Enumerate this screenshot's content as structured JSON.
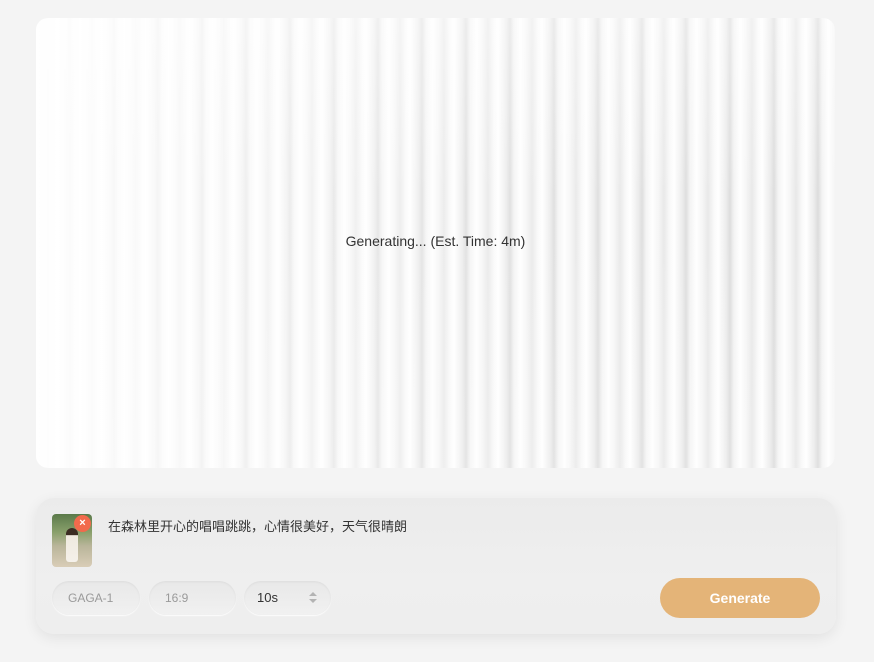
{
  "preview": {
    "status": "Generating... (Est. Time: 4m)"
  },
  "composer": {
    "prompt": "在森林里开心的唱唱跳跳，心情很美好，天气很晴朗",
    "model": "GAGA-1",
    "aspect_ratio": "16:9",
    "duration": "10s",
    "generate_label": "Generate",
    "remove_icon": "×"
  },
  "colors": {
    "accent": "#e4b478",
    "remove": "#f26a4c"
  }
}
